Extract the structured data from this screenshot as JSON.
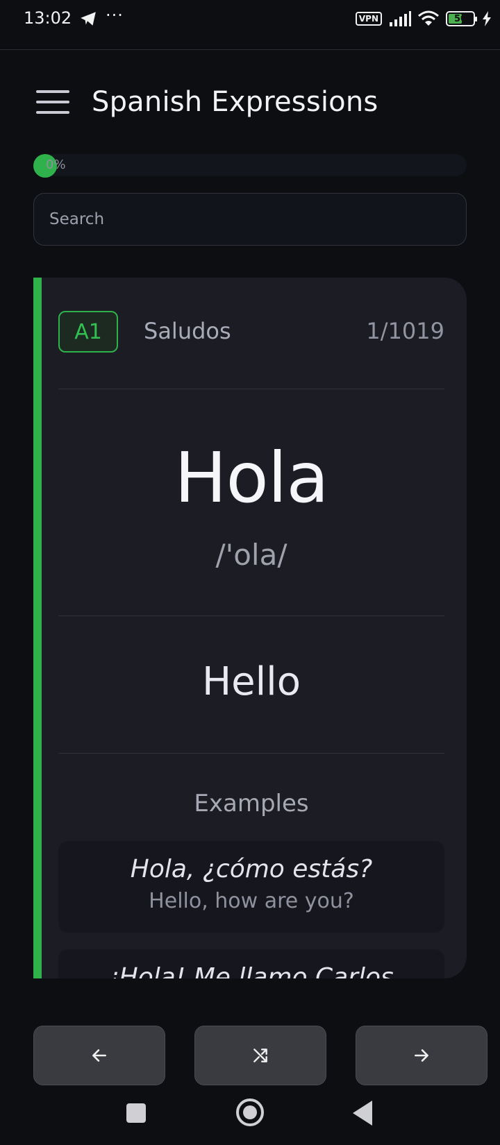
{
  "status_bar": {
    "time": "13:02",
    "dots": "···",
    "vpn_label": "VPN",
    "battery_level": "50",
    "icons": [
      "telegram-icon",
      "more-icon",
      "vpn-icon",
      "signal-icon",
      "wifi-icon",
      "battery-icon",
      "charging-icon"
    ]
  },
  "app_bar": {
    "title": "Spanish Expressions",
    "menu_icon": "hamburger-icon"
  },
  "progress": {
    "label": "0%",
    "value": 0
  },
  "search": {
    "placeholder": "Search",
    "value": ""
  },
  "card": {
    "level": "A1",
    "category": "Saludos",
    "counter": "1/1019",
    "word": "Hola",
    "phonetic": "/'ola/",
    "translation": "Hello",
    "examples_title": "Examples",
    "examples": [
      {
        "es": "Hola, ¿cómo estás?",
        "en": "Hello, how are you?"
      },
      {
        "es": "¡Hola! Me llamo Carlos",
        "en": ""
      }
    ]
  },
  "nav_buttons": {
    "prev_icon": "arrow-left-icon",
    "shuffle_icon": "shuffle-icon",
    "next_icon": "arrow-right-icon"
  },
  "colors": {
    "accent": "#2fb24b",
    "background": "#0d0e12",
    "card": "#1b1c24"
  }
}
